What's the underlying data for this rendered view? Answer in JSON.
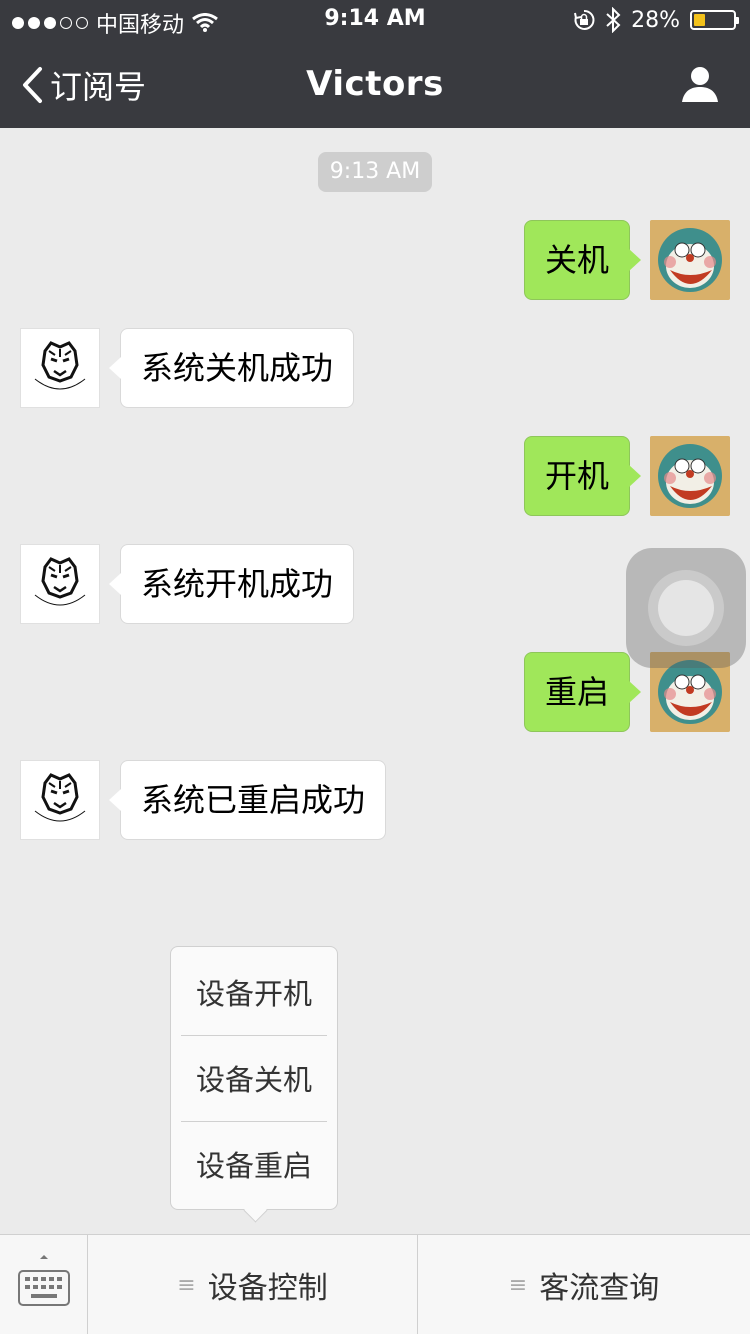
{
  "status_bar": {
    "carrier": "中国移动",
    "time": "9:14 AM",
    "battery_percent": "28%",
    "battery_level": 0.28,
    "battery_color": "#f3c21b",
    "icons": [
      "signal-dots-icon",
      "wifi-icon",
      "rotation-lock-icon",
      "bluetooth-icon",
      "battery-icon"
    ]
  },
  "nav": {
    "back_label": "订阅号",
    "title": "Victors",
    "profile_icon": "person-icon"
  },
  "chat": {
    "timestamp": "9:13 AM",
    "messages": [
      {
        "from": "me",
        "text": "关机"
      },
      {
        "from": "bot",
        "text": "系统关机成功"
      },
      {
        "from": "me",
        "text": "开机"
      },
      {
        "from": "bot",
        "text": "系统开机成功"
      },
      {
        "from": "me",
        "text": "重启"
      },
      {
        "from": "bot",
        "text": "系统已重启成功"
      }
    ],
    "bubble_colors": {
      "me": "#a0e75a",
      "bot": "#ffffff"
    }
  },
  "popup_menu": {
    "items": [
      "设备开机",
      "设备关机",
      "设备重启"
    ]
  },
  "bottom_menu": {
    "keyboard_icon": "keyboard-icon",
    "buttons": [
      {
        "label": "设备控制"
      },
      {
        "label": "客流查询"
      }
    ]
  },
  "bot_logo_text": "Victors"
}
